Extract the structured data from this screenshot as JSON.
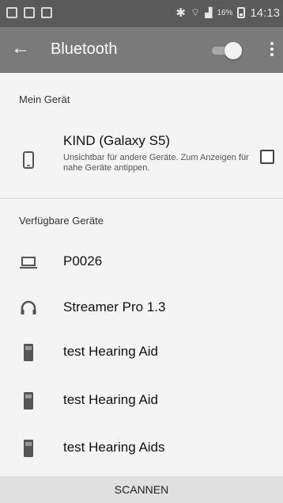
{
  "status_bar": {
    "battery": "16%",
    "time": "14:13",
    "icons": [
      "message-icon",
      "image-icon",
      "notification-icon",
      "bluetooth-icon",
      "wifi-icon",
      "signal-icon",
      "battery-icon"
    ]
  },
  "app_bar": {
    "title": "Bluetooth",
    "bluetooth_enabled": true,
    "back_icon": "arrow-left-icon",
    "more_icon": "more-vert-icon"
  },
  "my_device": {
    "section_label": "Mein Gerät",
    "name": "KIND (Galaxy S5)",
    "subtitle": "Unsichtbar für andere Geräte. Zum Anzeigen für nahe Geräte antippen.",
    "visible_checked": false,
    "icon": "phone-icon"
  },
  "available": {
    "section_label": "Verfügbare Geräte",
    "devices": [
      {
        "name": "P0026",
        "icon": "laptop-icon"
      },
      {
        "name": "Streamer Pro 1.3",
        "icon": "headset-icon"
      },
      {
        "name": "test Hearing Aid",
        "icon": "device-icon"
      },
      {
        "name": "test Hearing Aid",
        "icon": "device-icon"
      },
      {
        "name": "test Hearing Aids",
        "icon": "device-icon"
      }
    ]
  },
  "scan_button": "SCANNEN"
}
